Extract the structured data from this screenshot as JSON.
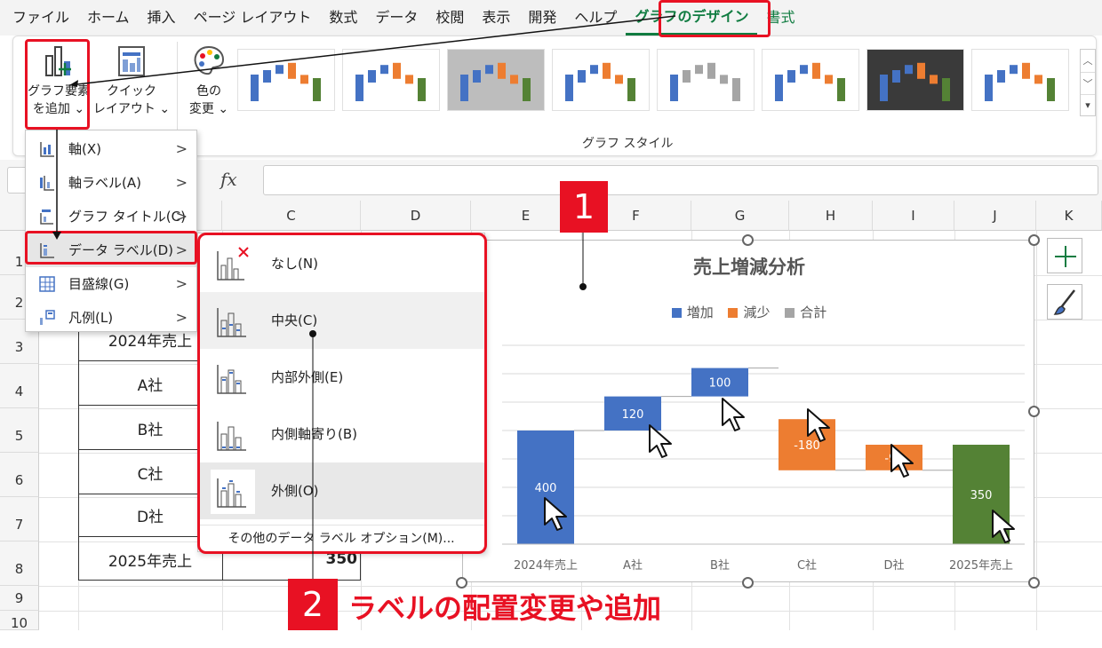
{
  "tabs": [
    {
      "label": "ファイル"
    },
    {
      "label": "ホーム"
    },
    {
      "label": "挿入"
    },
    {
      "label": "ページ レイアウト"
    },
    {
      "label": "数式"
    },
    {
      "label": "データ"
    },
    {
      "label": "校閲"
    },
    {
      "label": "表示"
    },
    {
      "label": "開発"
    },
    {
      "label": "ヘルプ"
    },
    {
      "label": "グラフのデザイン"
    },
    {
      "label": "書式"
    }
  ],
  "ribbon": {
    "add_element": {
      "line1": "グラフ要素",
      "line2": "を追加 ⌄"
    },
    "quick_layout": {
      "line1": "クイック",
      "line2": "レイアウト ⌄"
    },
    "change_color": {
      "line1": "色の",
      "line2": "変更 ⌄"
    },
    "group_label": "グラフ スタイル"
  },
  "formula_bar": {
    "fx": "fx"
  },
  "columns": [
    "C",
    "D",
    "E",
    "F",
    "G",
    "H",
    "I",
    "J",
    "K"
  ],
  "rows": [
    "1",
    "2",
    "3",
    "4",
    "5",
    "6",
    "7",
    "8",
    "9",
    "10"
  ],
  "table": {
    "labels": [
      "2024年売上",
      "A社",
      "B社",
      "C社",
      "D社",
      "2025年売上"
    ],
    "partial_value": "350"
  },
  "menu1": {
    "items": [
      {
        "label": "軸(X)"
      },
      {
        "label": "軸ラベル(A)"
      },
      {
        "label": "グラフ タイトル(C)"
      },
      {
        "label": "データ ラベル(D)"
      },
      {
        "label": "目盛線(G)"
      },
      {
        "label": "凡例(L)"
      }
    ],
    "arrow": ">"
  },
  "menu2": {
    "items": [
      {
        "label": "なし(N)"
      },
      {
        "label": "中央(C)"
      },
      {
        "label": "内部外側(E)"
      },
      {
        "label": "内側軸寄り(B)"
      },
      {
        "label": "外側(O)"
      }
    ],
    "more": "その他のデータ ラベル オプション(M)..."
  },
  "badges": {
    "one": "1",
    "two": "2"
  },
  "caption": "ラベルの配置変更や追加",
  "colors": {
    "increase": "#4472c4",
    "decrease": "#ed7d31",
    "total_start": "#4472c4",
    "total_end": "#548235",
    "legend_total": "#a5a5a5",
    "accent_red": "#e81123",
    "excel_green": "#107c41"
  },
  "chart_data": {
    "type": "bar",
    "subtype": "waterfall",
    "title": "売上増減分析",
    "legend": [
      {
        "name": "増加"
      },
      {
        "name": "減少"
      },
      {
        "name": "合計"
      }
    ],
    "categories": [
      "2024年売上",
      "A社",
      "B社",
      "C社",
      "D社",
      "2025年売上"
    ],
    "values": [
      400,
      120,
      100,
      -180,
      -90,
      350
    ],
    "base": [
      0,
      400,
      520,
      440,
      350,
      0
    ],
    "ylim": [
      0,
      700
    ],
    "data_labels": [
      "400",
      "120",
      "100",
      "-180",
      "-90",
      "350"
    ],
    "grid": true
  }
}
